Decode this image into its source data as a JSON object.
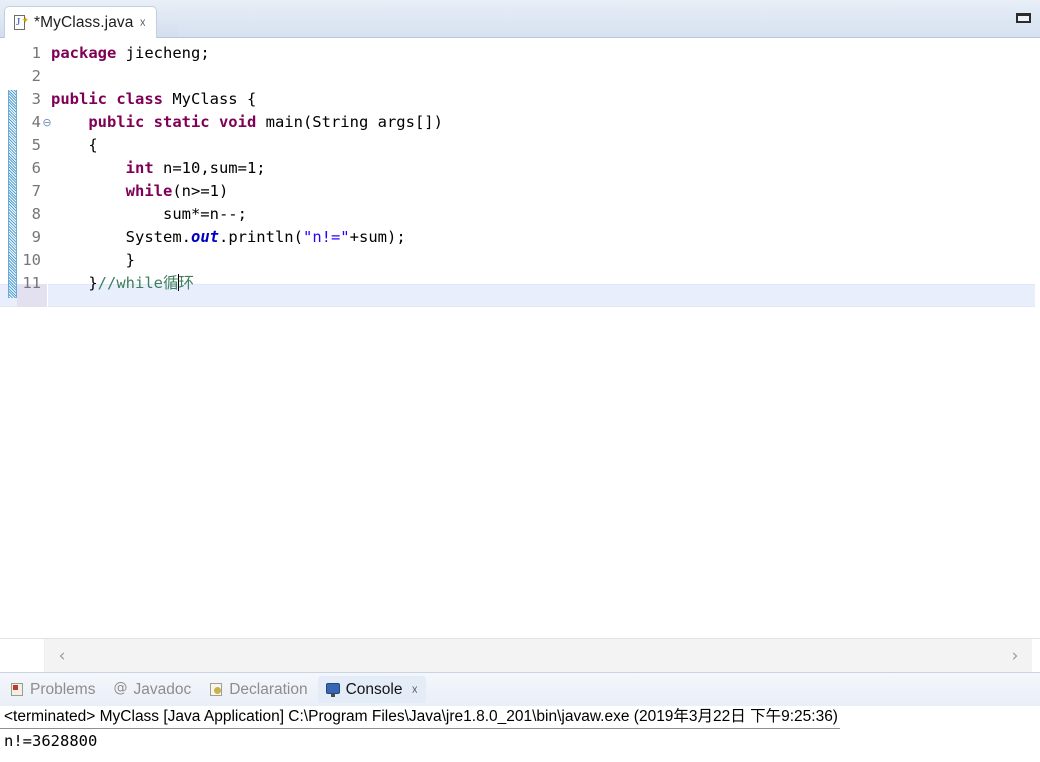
{
  "editor": {
    "tab": {
      "label": "*MyClass.java",
      "file_icon": "java-file-icon",
      "close_glyph": "☓"
    },
    "maximize_glyph": "maximize-icon",
    "lines": [
      {
        "number": "1",
        "fold": "",
        "tokens": [
          {
            "text": "package",
            "cls": "kw"
          },
          {
            "text": " jiecheng;",
            "cls": "pln"
          }
        ]
      },
      {
        "number": "2",
        "fold": "",
        "tokens": [
          {
            "text": "",
            "cls": "pln"
          }
        ]
      },
      {
        "number": "3",
        "fold": "",
        "tokens": [
          {
            "text": "public class",
            "cls": "kw"
          },
          {
            "text": " MyClass {",
            "cls": "pln"
          }
        ]
      },
      {
        "number": "4",
        "fold": "⊖",
        "tokens": [
          {
            "text": "    ",
            "cls": "pln"
          },
          {
            "text": "public static void",
            "cls": "kw"
          },
          {
            "text": " main(String args[])",
            "cls": "pln"
          }
        ]
      },
      {
        "number": "5",
        "fold": "",
        "tokens": [
          {
            "text": "    {",
            "cls": "pln"
          }
        ]
      },
      {
        "number": "6",
        "fold": "",
        "tokens": [
          {
            "text": "        ",
            "cls": "pln"
          },
          {
            "text": "int",
            "cls": "kw"
          },
          {
            "text": " n=10,sum=1;",
            "cls": "pln"
          }
        ]
      },
      {
        "number": "7",
        "fold": "",
        "tokens": [
          {
            "text": "        ",
            "cls": "pln"
          },
          {
            "text": "while",
            "cls": "kw"
          },
          {
            "text": "(n>=1)",
            "cls": "pln"
          }
        ]
      },
      {
        "number": "8",
        "fold": "",
        "tokens": [
          {
            "text": "            sum*=n--;",
            "cls": "pln"
          }
        ]
      },
      {
        "number": "9",
        "fold": "",
        "tokens": [
          {
            "text": "        System.",
            "cls": "pln"
          },
          {
            "text": "out",
            "cls": "fld"
          },
          {
            "text": ".println(",
            "cls": "pln"
          },
          {
            "text": "\"n!=\"",
            "cls": "str"
          },
          {
            "text": "+sum);",
            "cls": "pln"
          }
        ]
      },
      {
        "number": "10",
        "fold": "",
        "tokens": [
          {
            "text": "        }",
            "cls": "pln"
          }
        ]
      },
      {
        "number": "11",
        "fold": "",
        "tokens": [
          {
            "text": "    }",
            "cls": "pln"
          },
          {
            "text": "//while循",
            "cls": "cmt"
          },
          {
            "text": "__CARET__",
            "cls": "caret-token"
          },
          {
            "text": "环",
            "cls": "cmt"
          }
        ]
      }
    ],
    "scroll_left_glyph": "‹",
    "scroll_right_glyph": "›"
  },
  "bottom_panel": {
    "tabs": [
      {
        "label": "Problems",
        "icon": "problems-icon",
        "active": false,
        "closable": false
      },
      {
        "label": "Javadoc",
        "icon": "javadoc-icon",
        "active": false,
        "closable": false
      },
      {
        "label": "Declaration",
        "icon": "declaration-icon",
        "active": false,
        "closable": false
      },
      {
        "label": "Console",
        "icon": "console-icon",
        "active": true,
        "closable": true
      }
    ],
    "close_glyph": "☓",
    "console": {
      "header": "<terminated> MyClass [Java Application] C:\\Program Files\\Java\\jre1.8.0_201\\bin\\javaw.exe (2019年3月22日 下午9:25:36)",
      "output": "n!=3628800"
    }
  },
  "colors": {
    "keyword": "#7f0055",
    "string": "#2a00ff",
    "comment": "#3f7f5f",
    "field": "#0000c0",
    "current_line": "#e8eefb",
    "change_bar": "#4f9fd4",
    "tab_active_bg": "#e4ecf8"
  }
}
